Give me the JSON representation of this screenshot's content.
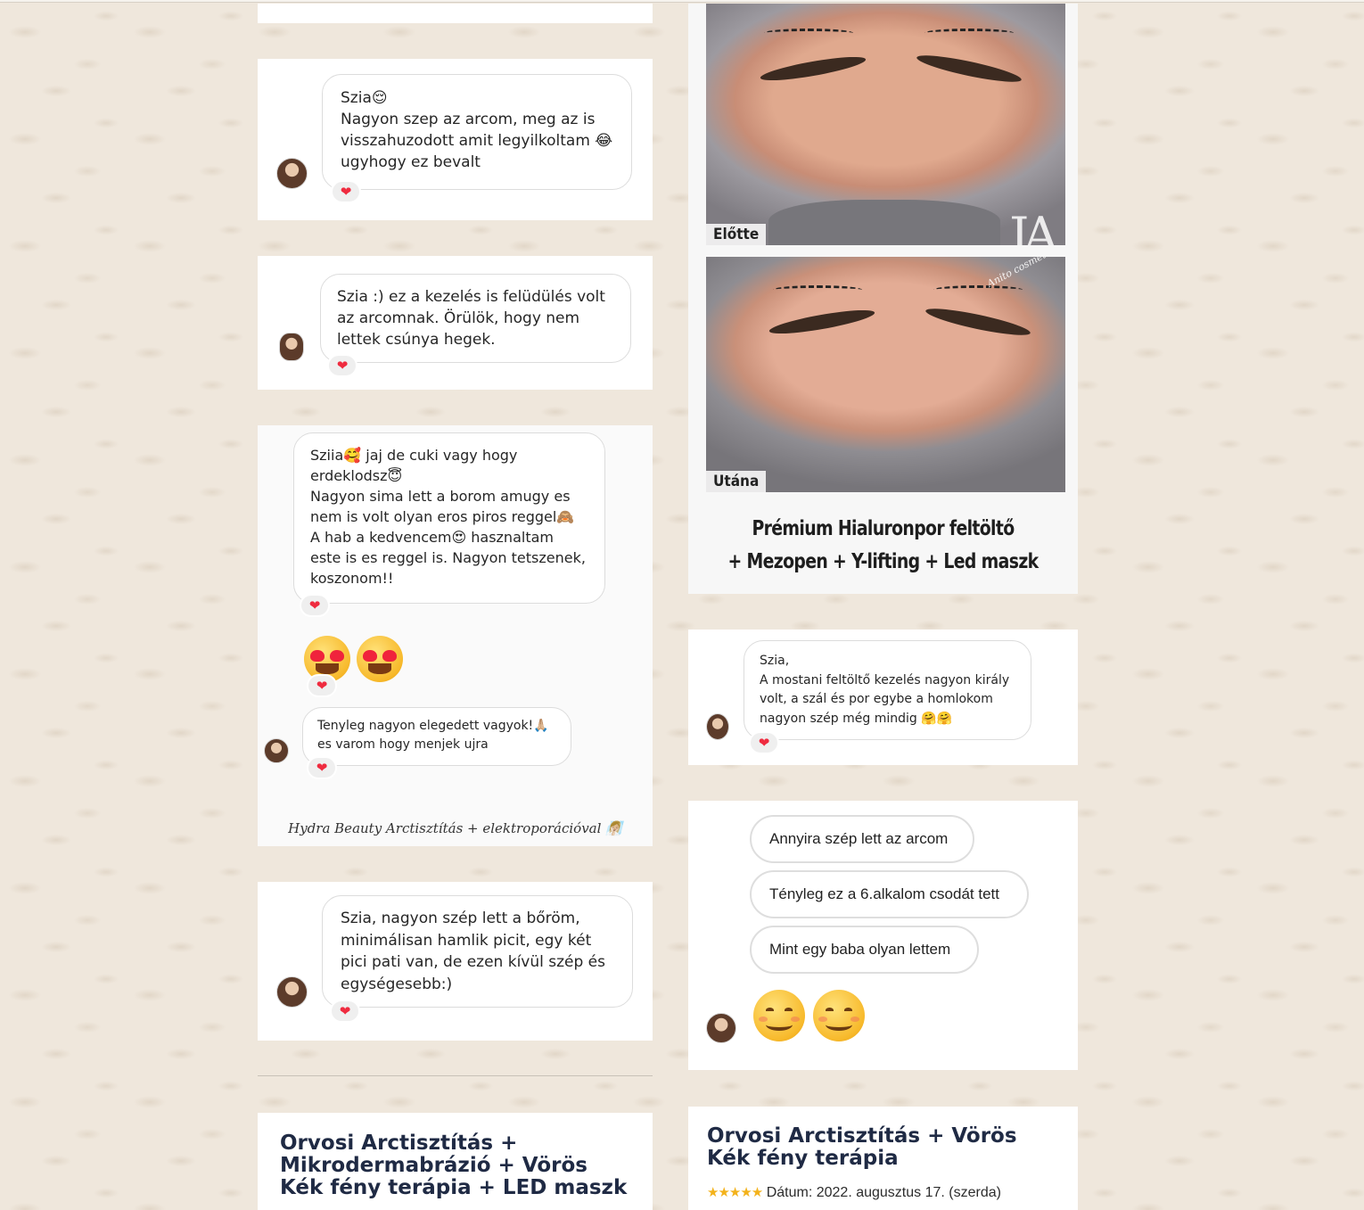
{
  "testimonials": {
    "t1": {
      "text": "Szia😌\nNagyon szep az arcom, meg az is visszahuzodott amit legyilkoltam 😂\nugyhogy ez bevalt"
    },
    "t2": {
      "text": "Szia :) ez a kezelés is felüdülés volt az arcomnak. Örülök, hogy nem lettek csúnya hegek."
    },
    "t3": {
      "text": "Sziia🥰 jaj de cuki vagy hogy erdeklodsz😇\nNagyon sima lett a borom amugy es nem is volt olyan eros piros reggel🙈 A hab a kedvencem😍 hasznaltam este is es reggel is. Nagyon tetszenek, koszonom!!",
      "reply": "Tenyleg nagyon elegedett vagyok!🙏🏼\nes varom hogy menjek ujra",
      "caption": "Hydra Beauty Arctisztítás + elektroporációval 🧖🏼‍♀️"
    },
    "t4": {
      "text": "Szia, nagyon szép lett a bőröm, minimálisan hamlik picit, egy két pici pati van, de ezen kívül szép és egységesebb:)"
    },
    "t5": {
      "text": "Szia,\nA mostani feltöltő kezelés nagyon király volt, a szál és por egybe a homlokom nagyon szép még mindig 🤗🤗"
    },
    "t6": {
      "messages": [
        "Annyira szép lett az arcom",
        "Tényleg ez a 6.alkalom csodát tett",
        "Mint egy baba olyan lettem"
      ]
    }
  },
  "before_after": {
    "before_label": "Előtte",
    "after_label": "Utána",
    "watermark": "JA",
    "watermark_sub": "Anito cosmetics",
    "title_line1": "Prémium Hialuronpor feltöltő",
    "title_line2": "+ Mezopen + Y-lifting + Led maszk"
  },
  "articles": {
    "left_title": "Orvosi Arctisztítás + Mikrodermabrázió + Vörös Kék fény terápia + LED maszk",
    "right_title": "Orvosi Arctisztítás + Vörös Kék fény terápia",
    "right_rating_stars": "★★★★★",
    "right_date": "Dátum: 2022. augusztus 17. (szerda)"
  },
  "colors": {
    "heart": "#ef2b3f",
    "title_navy": "#1f2a44",
    "star": "#f3b21b"
  }
}
